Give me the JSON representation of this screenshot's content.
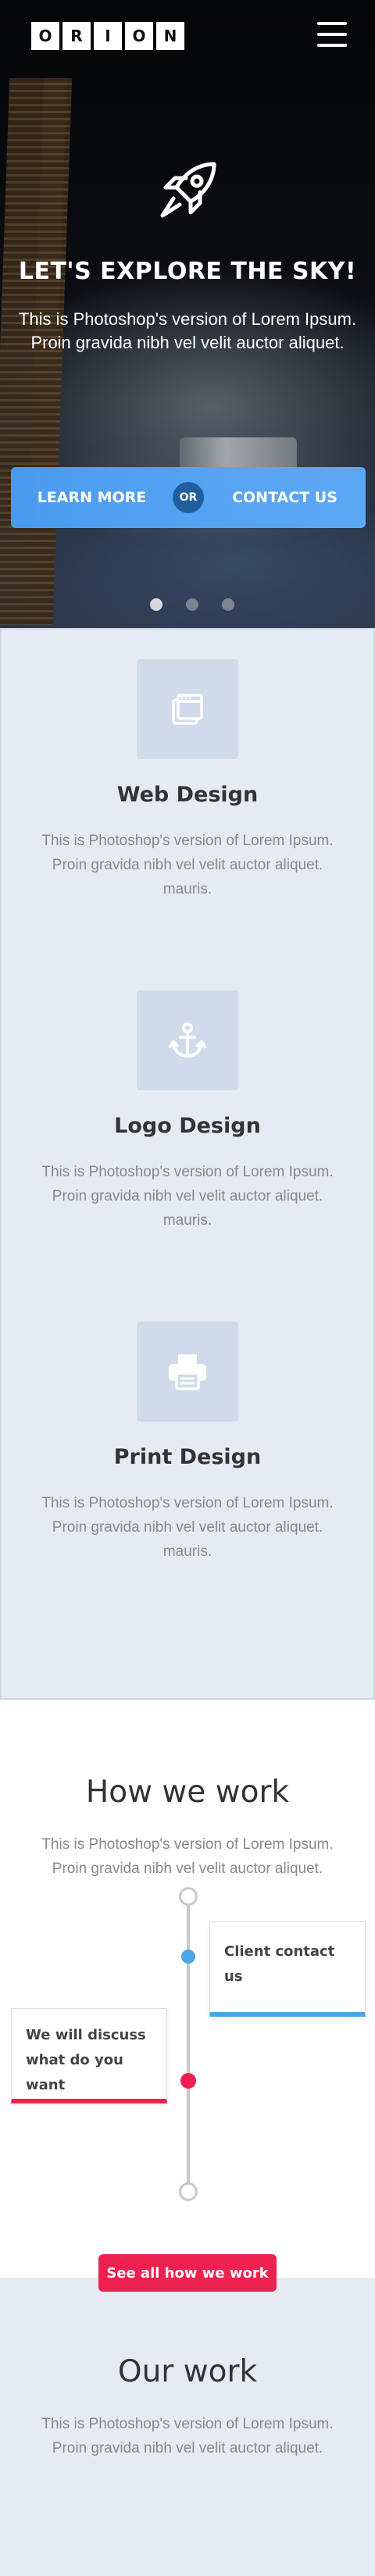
{
  "header": {
    "logo_letters": [
      "O",
      "R",
      "I",
      "O",
      "N"
    ]
  },
  "hero": {
    "title": "LET'S EXPLORE THE SKY!",
    "subtitle": "This is Photoshop's version  of Lorem Ipsum. Proin gravida nibh vel velit auctor aliquet.",
    "learn_more": "LEARN MORE",
    "or": "OR",
    "contact_us": "CONTACT US",
    "slides_total": 3,
    "slide_active": 1,
    "accent_color": "#4a9bf0"
  },
  "services": [
    {
      "icon": "web-design-icon",
      "title": "Web Design",
      "text": "This is Photoshop's version  of Lorem Ipsum. Proin gravida nibh vel velit auctor aliquet. mauris."
    },
    {
      "icon": "anchor-icon",
      "title": "Logo Design",
      "text": "This is Photoshop's version  of Lorem Ipsum. Proin gravida nibh vel velit auctor aliquet. mauris."
    },
    {
      "icon": "printer-icon",
      "title": "Print Design",
      "text": "This is Photoshop's version  of Lorem Ipsum. Proin gravida nibh vel velit auctor aliquet. mauris."
    }
  ],
  "how_we_work": {
    "title": "How we work",
    "subtitle": "This is Photoshop's version  of Lorem Ipsum. Proin gravida nibh vel velit auctor aliquet.",
    "steps": [
      {
        "label": "Client contact us",
        "color": "#4ba6e8"
      },
      {
        "label": "We will discuss what do you want",
        "color": "#ec2150"
      }
    ],
    "cta": "See all how we work"
  },
  "our_work": {
    "title": "Our work",
    "subtitle": "This is Photoshop's version  of Lorem Ipsum. Proin gravida nibh vel velit auctor aliquet."
  }
}
